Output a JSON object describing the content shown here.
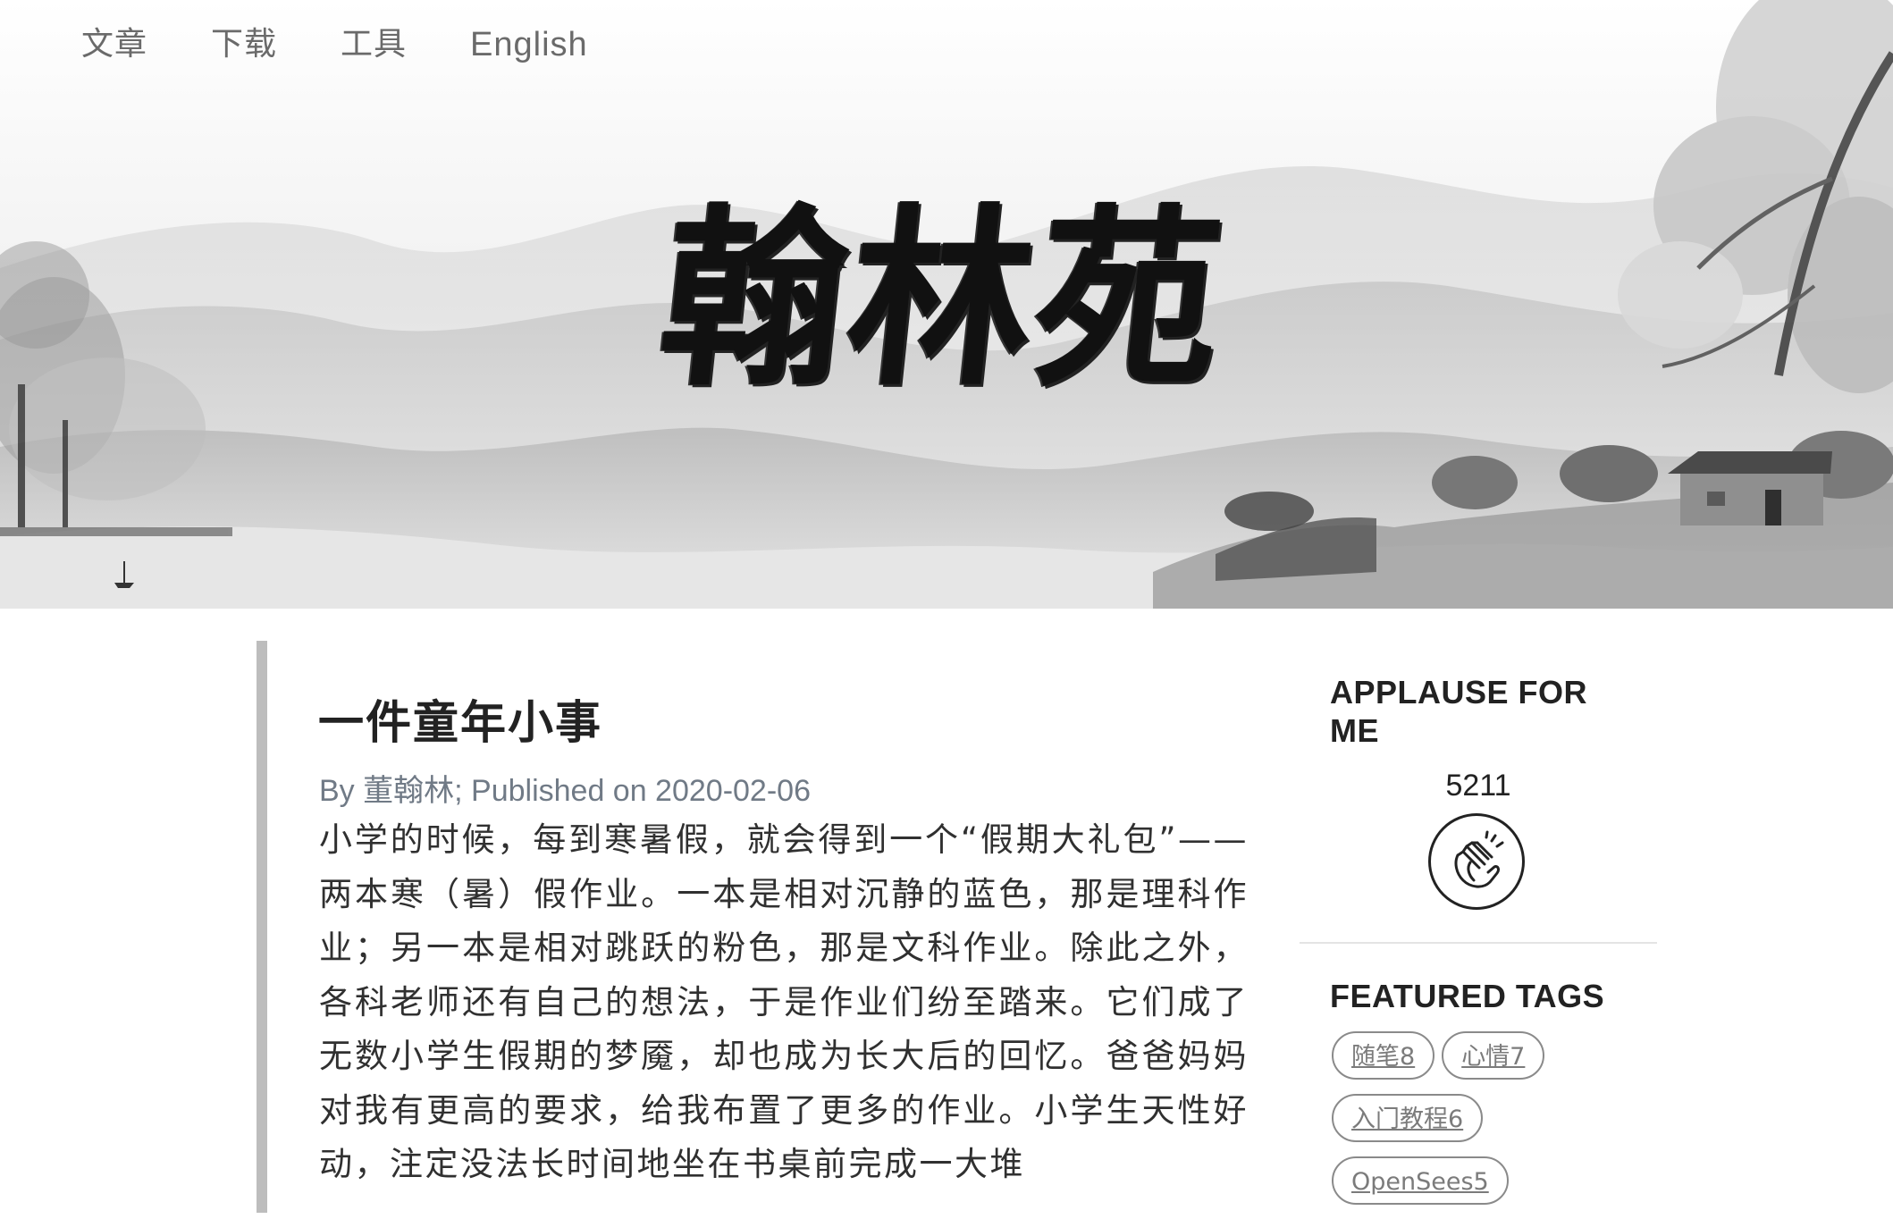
{
  "nav": {
    "items": [
      {
        "label": "文章"
      },
      {
        "label": "下载"
      },
      {
        "label": "工具"
      },
      {
        "label": "English"
      }
    ]
  },
  "header": {
    "site_title": "翰林苑",
    "background": "ink-wash landscape painting"
  },
  "post": {
    "title": "一件童年小事",
    "meta_by": "By ",
    "meta_author": "董翰林",
    "meta_published": "; Published on 2020-02-06",
    "body": "小学的时候，每到寒暑假，就会得到一个“假期大礼包”——两本寒（暑）假作业。一本是相对沉静的蓝色，那是理科作业；另一本是相对跳跃的粉色，那是文科作业。除此之外，各科老师还有自己的想法，于是作业们纷至踏来。它们成了无数小学生假期的梦魇，却也成为长大后的回忆。爸爸妈妈对我有更高的要求，给我布置了更多的作业。小学生天性好动，注定没法长时间地坐在书桌前完成一大堆"
  },
  "sidebar": {
    "applause_heading": "APPLAUSE FOR ME",
    "applause_count": "5211",
    "applause_icon": "clapping-hands-icon",
    "tags_heading": "FEATURED TAGS",
    "tags": [
      {
        "label": "随笔8"
      },
      {
        "label": "心情7"
      },
      {
        "label": "入门教程6"
      },
      {
        "label": "OpenSees5"
      }
    ]
  },
  "colors": {
    "nav_text": "#6a6a6a",
    "meta_text": "#707a86",
    "post_border": "#bdbdbd",
    "tag_border": "#8a8a8a"
  }
}
